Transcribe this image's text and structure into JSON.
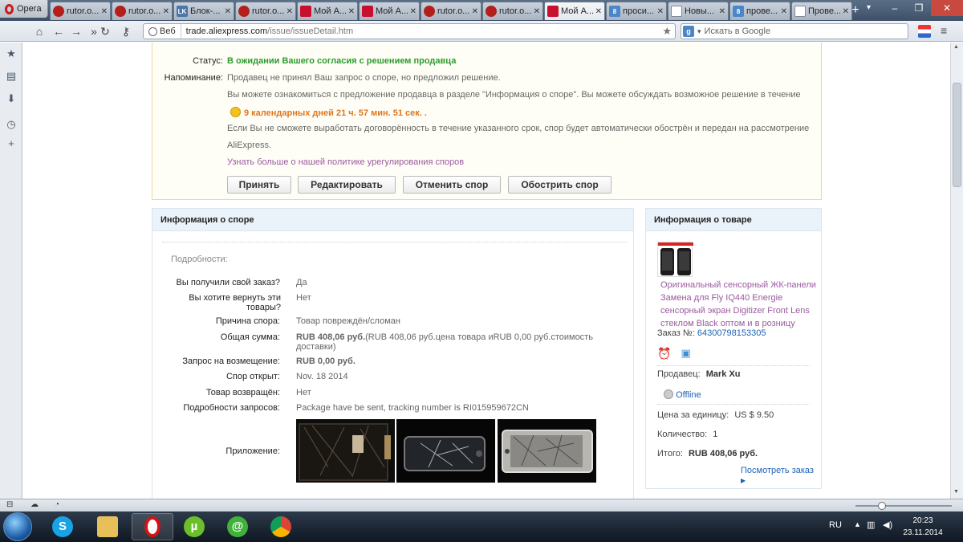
{
  "browser": {
    "menu_label": "Opera",
    "tabs": [
      {
        "label": "rutor.o...",
        "favicon": "rutor",
        "active": false
      },
      {
        "label": "rutor.o...",
        "favicon": "rutor",
        "active": false
      },
      {
        "label": "Блок-...",
        "favicon": "lk",
        "active": false
      },
      {
        "label": "rutor.o...",
        "favicon": "rutor",
        "active": false
      },
      {
        "label": "Мой А...",
        "favicon": "ali",
        "active": false
      },
      {
        "label": "Мой А...",
        "favicon": "ali",
        "active": false
      },
      {
        "label": "rutor.o...",
        "favicon": "rutor",
        "active": false
      },
      {
        "label": "rutor.o...",
        "favicon": "rutor",
        "active": false
      },
      {
        "label": "Мой А...",
        "favicon": "ali",
        "active": true
      },
      {
        "label": "проси...",
        "favicon": "g",
        "active": false
      },
      {
        "label": "Новы...",
        "favicon": "blank",
        "active": false
      },
      {
        "label": "прове...",
        "favicon": "g",
        "active": false
      },
      {
        "label": "Прове...",
        "favicon": "blank",
        "active": false
      }
    ],
    "address": {
      "scheme_label": "Веб",
      "host": "trade.aliexpress.com",
      "path": "/issue/issueDetail.htm"
    },
    "search_placeholder": "Искать в Google"
  },
  "status_box": {
    "status_label": "Статус:",
    "status_value": "В ожидании Вашего согласия с решением продавца",
    "reminder_label": "Напоминание:",
    "reminder_text": "Продавец не принял Ваш запрос о споре, но предложил решение.",
    "info_text": "Вы можете ознакомиться с предложение продавца в разделе \"Информация о споре\". Вы можете обсуждать возможное решение в течение",
    "countdown": "9 календарных дней 21 ч. 57 мин. 51 сек. .",
    "warning_line1": "Если Вы не сможете выработать договорённость в течение указанного срок, спор будет автоматически обострён и передан на рассмотрение",
    "warning_line2": "AliExpress.",
    "policy_link": "Узнать больше о нашей политике урегулирования споров",
    "buttons": {
      "accept": "Принять",
      "edit": "Редактировать",
      "cancel": "Отменить спор",
      "escalate": "Обострить спор"
    }
  },
  "dispute": {
    "title": "Информация о споре",
    "details_label": "Подробности:",
    "rows": [
      {
        "label": "Вы получили свой заказ?",
        "value": "Да"
      },
      {
        "label": "Вы хотите вернуть эти товары?",
        "value": "Нет"
      },
      {
        "label": "Причина спора:",
        "value": "Товар повреждён/сломан"
      },
      {
        "label": "Общая сумма:",
        "value_bold": "RUB 408,06 руб.",
        "value": "(RUB 408,06 руб.цена товара иRUB 0,00 руб.стоимость доставки)"
      },
      {
        "label": "Запрос на возмещение:",
        "value_orange": "RUB 0,00 руб."
      },
      {
        "label": "Спор открыт:",
        "value": "Nov. 18 2014"
      },
      {
        "label": "Товар возвращён:",
        "value": "Нет"
      },
      {
        "label": "Подробности запросов:",
        "value": "Package have be sent, tracking number is RI015959672CN"
      },
      {
        "label": "Приложение:",
        "value": ""
      }
    ]
  },
  "product": {
    "title": "Информация о товаре",
    "name": "Оригинальный сенсорный ЖК-панели Замена для Fly IQ440 Energie сенсорный экран Digitizer Front Lens стеклом Black оптом и в розницу",
    "order_label": "Заказ №:",
    "order_number": "64300798153305",
    "seller_label": "Продавец:",
    "seller_name": "Mark Xu",
    "seller_status": "Offline",
    "unit_price_label": "Цена за единицу:",
    "unit_price": "US $ 9.50",
    "quantity_label": "Количество:",
    "quantity": "1",
    "total_label": "Итого:",
    "total": "RUB 408,06 руб.",
    "view_order_link": "Посмотреть заказ"
  },
  "taskbar": {
    "lang": "RU",
    "time": "20:23",
    "date": "23.11.2014"
  },
  "colors": {
    "status_green": "#2c9b2e",
    "countdown_orange": "#e0761c",
    "link_purple": "#9b5aa0",
    "link_blue": "#1e63b6"
  }
}
